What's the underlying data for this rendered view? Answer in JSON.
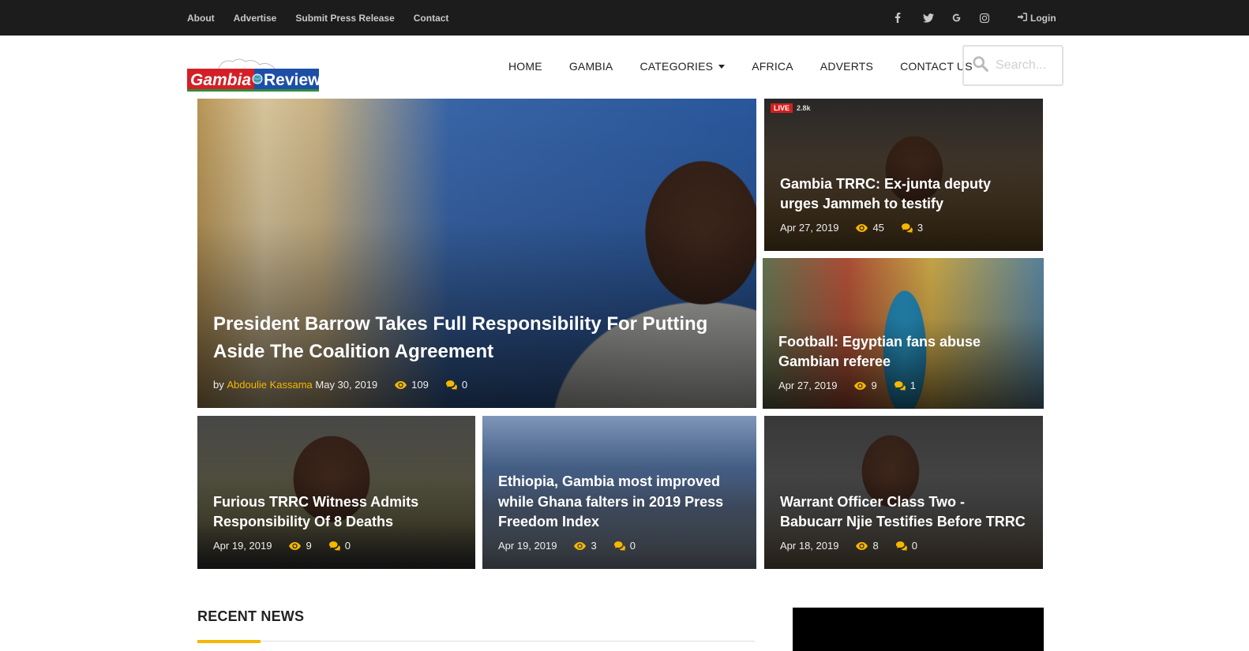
{
  "topbar": {
    "links": [
      "About",
      "Advertise",
      "Submit Press Release",
      "Contact"
    ],
    "social_icons": [
      "facebook-icon",
      "twitter-icon",
      "google-icon",
      "instagram-icon"
    ],
    "login_label": "Login"
  },
  "header": {
    "logo_text_left": "Gambia",
    "logo_text_right": "Review",
    "nav": [
      "HOME",
      "GAMBIA",
      "CATEGORIES",
      "AFRICA",
      "ADVERTS",
      "CONTACT US"
    ],
    "search_placeholder": "Search..."
  },
  "stories": {
    "featured": {
      "title": "President Barrow Takes Full Responsibility For Putting Aside The Coalition Agreement",
      "by": "by",
      "author": "Abdoulie Kassama",
      "date": "May 30, 2019",
      "views": "109",
      "comments": "0"
    },
    "right1": {
      "live_tag": "LIVE",
      "live_count": "2.8k",
      "title": "Gambia TRRC: Ex-junta deputy urges Jammeh to testify",
      "date": "Apr 27, 2019",
      "views": "45",
      "comments": "3"
    },
    "right2": {
      "title": "Football: Egyptian fans abuse Gambian referee",
      "date": "Apr 27, 2019",
      "views": "9",
      "comments": "1"
    },
    "bottom1": {
      "title": "Furious TRRC Witness Admits Responsibility Of 8 Deaths",
      "date": "Apr 19, 2019",
      "views": "9",
      "comments": "0"
    },
    "bottom2": {
      "title": "Ethiopia, Gambia most improved while Ghana falters in 2019 Press Freedom Index",
      "date": "Apr 19, 2019",
      "views": "3",
      "comments": "0"
    },
    "bottom3": {
      "title": "Warrant Officer Class Two - Babucarr Njie Testifies Before TRRC",
      "date": "Apr 18, 2019",
      "views": "8",
      "comments": "0"
    }
  },
  "sections": {
    "recent_news": "RECENT NEWS"
  },
  "colors": {
    "topbar": "#1c1c1c",
    "accent": "#f5b700"
  }
}
